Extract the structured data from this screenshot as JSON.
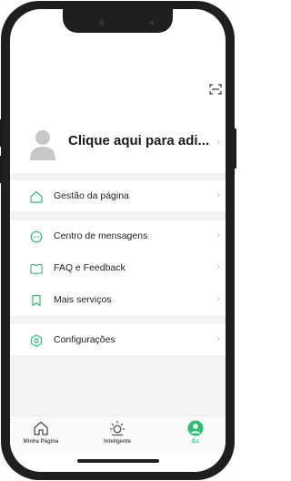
{
  "colors": {
    "accent": "#2fbf71",
    "divider": "#f2f3f5",
    "text": "#222222"
  },
  "header": {
    "scan_icon": "scan-icon"
  },
  "profile": {
    "name": "Clique aqui para adi..."
  },
  "menu": {
    "items": [
      {
        "label": "Gestão da página",
        "icon": "home-icon"
      },
      {
        "label": "Centro de mensagens",
        "icon": "message-icon"
      },
      {
        "label": "FAQ e Feedback",
        "icon": "book-icon"
      },
      {
        "label": "Mais serviços",
        "icon": "bookmark-icon"
      },
      {
        "label": "Configurações",
        "icon": "settings-icon"
      }
    ]
  },
  "tabbar": {
    "tabs": [
      {
        "label": "Minha Página",
        "icon": "home-icon",
        "active": false
      },
      {
        "label": "Inteligente",
        "icon": "sun-icon",
        "active": false
      },
      {
        "label": "Eu",
        "icon": "user-icon",
        "active": true
      }
    ]
  }
}
